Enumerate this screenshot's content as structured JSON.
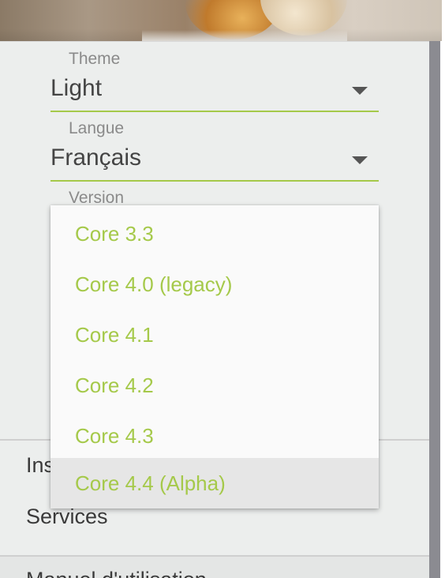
{
  "settings": {
    "theme": {
      "label": "Theme",
      "value": "Light"
    },
    "language": {
      "label": "Langue",
      "value": "Français"
    },
    "version": {
      "label": "Version",
      "options": [
        "Core 3.3",
        "Core 4.0 (legacy)",
        "Core 4.1",
        "Core 4.2",
        "Core 4.3",
        "Core 4.4 (Alpha)"
      ],
      "highlighted_option": "Core 4.4 (Alpha)"
    }
  },
  "menu": {
    "items": [
      "Ins",
      "Services",
      "Manuel d'utilisation"
    ]
  },
  "colors": {
    "accent": "#a5c94a",
    "panel_background": "#eceeed",
    "dropdown_background": "#fafafa",
    "highlight": "#e6e6e6",
    "scrollbar": "#8b8b91"
  }
}
